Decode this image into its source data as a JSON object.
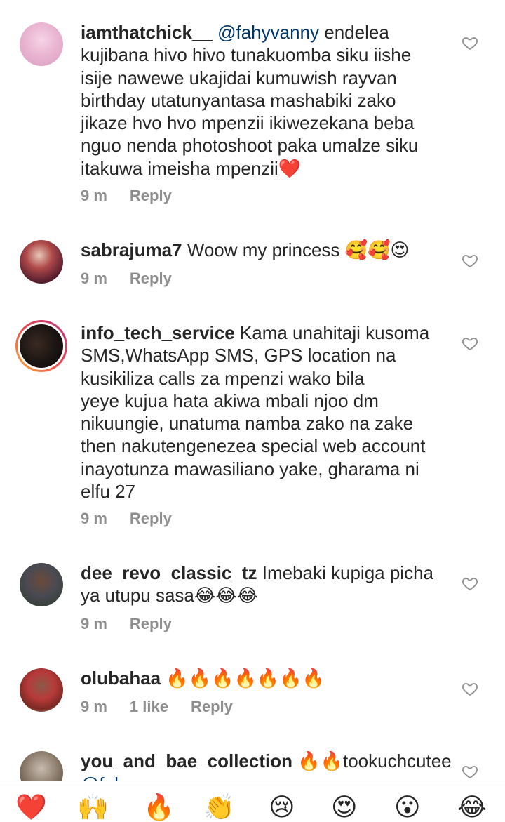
{
  "comments": [
    {
      "username": "iamthatchick__",
      "mention": "@fahyvanny",
      "text": " endelea\nkujibana hivo hivo tunakuomba siku iishe\nisije nawewe ukajidai kumuwish rayvan\nbirthday utatunyantasa mashabiki zako\njikaze hvo hvo mpenzii ikiwezekana beba\nnguo nenda photoshoot paka umalze siku\nitakuwa imeisha mpenzii",
      "emoji": "❤️",
      "time": "9 m",
      "reply": "Reply"
    },
    {
      "username": "sabrajuma7",
      "text": " Woow my princess ",
      "emoji": "🥰🥰😍",
      "time": "9 m",
      "reply": "Reply"
    },
    {
      "username": "info_tech_service",
      "text": " Kama unahitaji kusoma\nSMS,WhatsApp SMS, GPS location na\nkusikiliza calls za mpenzi wako bila\nyeye kujua hata akiwa mbali njoo dm\nnikuungie, unatuma namba zako na zake\nthen nakutengenezea special web account\ninayotunza mawasiliano yake, gharama ni\nelfu 27",
      "time": "9 m",
      "reply": "Reply"
    },
    {
      "username": "dee_revo_classic_tz",
      "text": " Imebaki kupiga picha\nya utupu sasa",
      "emoji": "😂😂😂",
      "time": "9 m",
      "reply": "Reply"
    },
    {
      "username": "olubahaa",
      "text": " ",
      "emoji": "🔥🔥🔥🔥🔥🔥🔥",
      "time": "9 m",
      "likes": "1 like",
      "reply": "Reply"
    },
    {
      "username": "you_and_bae_collection",
      "text": " ",
      "emoji": "🔥🔥",
      "text2": "tookuchcutee",
      "mention2": "@fahyvanny"
    }
  ],
  "emoji_bar": [
    "❤️",
    "🙌",
    "🔥",
    "👏",
    "😢",
    "😍",
    "😮",
    "😂"
  ]
}
